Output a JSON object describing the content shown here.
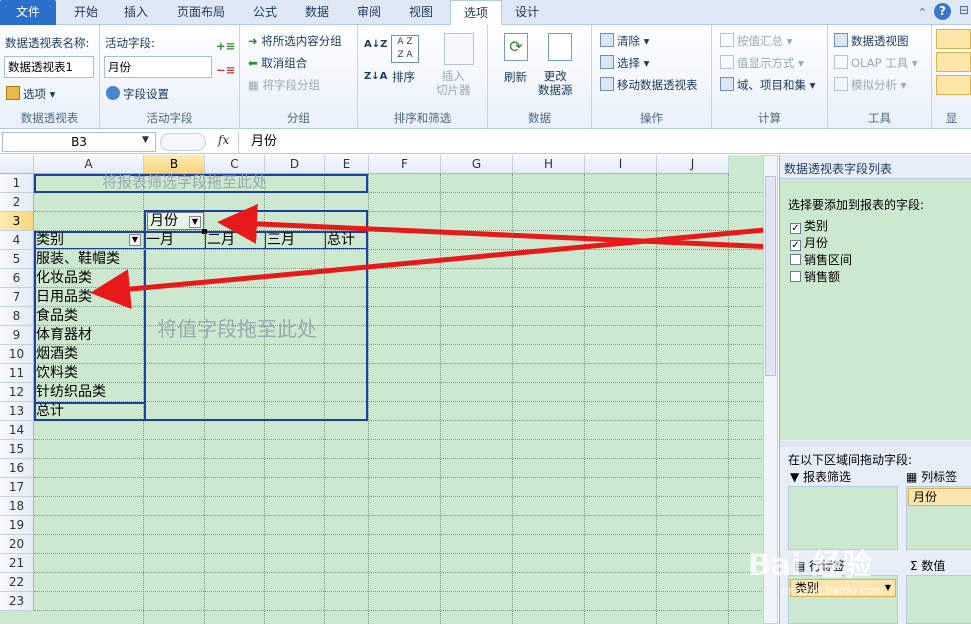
{
  "tabs": {
    "file": "文件",
    "home": "开始",
    "insert": "插入",
    "layout": "页面布局",
    "formula": "公式",
    "data": "数据",
    "review": "审阅",
    "view": "视图",
    "options": "选项",
    "design": "设计"
  },
  "ribbon": {
    "pt_name_label": "数据透视表名称:",
    "pt_name_value": "数据透视表1",
    "options_btn": "选项",
    "active_field_label": "活动字段:",
    "active_field_value": "月份",
    "field_settings": "字段设置",
    "group_selection": "将所选内容分组",
    "ungroup": "取消组合",
    "group_field": "将字段分组",
    "sort": "排序",
    "insert_slicer": "插入\n切片器",
    "refresh": "刷新",
    "change_source": "更改\n数据源",
    "clear": "清除",
    "select": "选择",
    "move_pt": "移动数据透视表",
    "summarize_by": "按值汇总",
    "show_values_as": "值显示方式",
    "fields_items_sets": "域、项目和集",
    "pivot_chart": "数据透视图",
    "olap_tools": "OLAP 工具",
    "what_if": "模拟分析",
    "groups": {
      "pivottable": "数据透视表",
      "active_field": "活动字段",
      "group": "分组",
      "sort_filter": "排序和筛选",
      "data": "数据",
      "actions": "操作",
      "calculations": "计算",
      "tools": "工具",
      "show": "显"
    }
  },
  "formula_bar": {
    "name_box": "B3",
    "fx": "fx",
    "value": "月份"
  },
  "columns": [
    "A",
    "B",
    "C",
    "D",
    "E",
    "F",
    "G",
    "H",
    "I",
    "J"
  ],
  "rows": [
    "1",
    "2",
    "3",
    "4",
    "5",
    "6",
    "7",
    "8",
    "9",
    "10",
    "11",
    "12",
    "13",
    "14",
    "15",
    "16",
    "17",
    "18",
    "19",
    "20",
    "21",
    "22",
    "23"
  ],
  "sheet": {
    "filter_drop": "将报表筛选字段拖至此处",
    "col_field": "月份",
    "row_field": "类别",
    "months": [
      "一月",
      "二月",
      "三月"
    ],
    "total_col": "总计",
    "categories": [
      "服装、鞋帽类",
      "化妆品类",
      "日用品类",
      "食品类",
      "体育器材",
      "烟酒类",
      "饮料类",
      "针纺织品类"
    ],
    "total_row": "总计",
    "value_drop": "将值字段拖至此处"
  },
  "panel": {
    "title": "数据透视表字段列表",
    "choose_label": "选择要添加到报表的字段:",
    "fields": [
      {
        "label": "类别",
        "checked": true
      },
      {
        "label": "月份",
        "checked": true
      },
      {
        "label": "销售区间",
        "checked": false
      },
      {
        "label": "销售额",
        "checked": false
      }
    ],
    "drag_label": "在以下区域间拖动字段:",
    "report_filter": "报表筛选",
    "column_labels": "列标签",
    "row_labels": "行标签",
    "values": "数值",
    "col_item": "月份",
    "row_item": "类别"
  },
  "watermark": "Bai 经验",
  "watermark_url": "jingyan.baidu.com",
  "colors": {
    "accent": "#2a6fc9",
    "arrow": "#e8191a",
    "grid_bg": "#cce8cf",
    "pivot_border": "#1f3fa0"
  }
}
